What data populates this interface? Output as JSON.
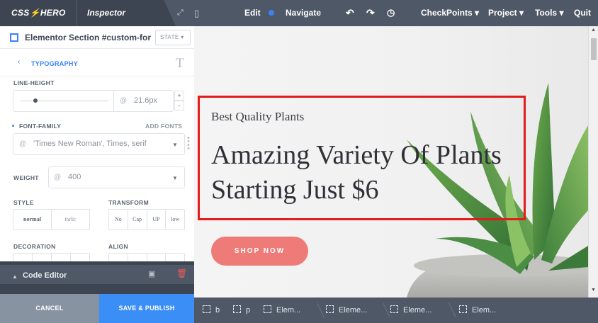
{
  "topbar": {
    "logo": "CSS⚡HERO",
    "inspector_tab": "Inspector",
    "edit_label": "Edit",
    "navigate_label": "Navigate",
    "menus": [
      "CheckPoints ▾",
      "Project ▾",
      "Tools ▾",
      "Quit"
    ]
  },
  "panel": {
    "selector_title": "Elementor Section #custom-for",
    "state_label": "STATE ▾",
    "section_label": "TYPOGRAPHY",
    "section_icon": "T",
    "line_height": {
      "label": "LINE-HEIGHT",
      "value": "21.6px",
      "slider_level": 0.17
    },
    "font_family": {
      "label": "FONT-FAMILY",
      "add_fonts": "ADD FONTS",
      "value": "'Times New Roman', Times, serif"
    },
    "weight": {
      "label": "WEIGHT",
      "value": "400"
    },
    "style": {
      "label": "STYLE",
      "options": [
        "normal",
        "italic"
      ]
    },
    "transform": {
      "label": "TRANSFORM",
      "options": [
        "No",
        "Cap",
        "UP",
        "low"
      ]
    },
    "decoration": {
      "label": "DECORATION"
    },
    "align": {
      "label": "ALIGN"
    },
    "at_symbol": "@"
  },
  "code_editor": {
    "title": "Code Editor"
  },
  "footer": {
    "cancel": "CANCEL",
    "save": "SAVE & PUBLISH"
  },
  "preview": {
    "subtitle": "Best Quality Plants",
    "title": "Amazing Variety Of Plants Starting Just $6",
    "button": "SHOP NOW"
  },
  "breadcrumbs": [
    "b",
    "p",
    "Elem...",
    "Eleme...",
    "Eleme...",
    "Elem..."
  ],
  "colors": {
    "accent": "#3b82f6",
    "highlight": "#e31b1b",
    "shop_button": "#ef7b78",
    "toolbar": "#4f5867"
  }
}
